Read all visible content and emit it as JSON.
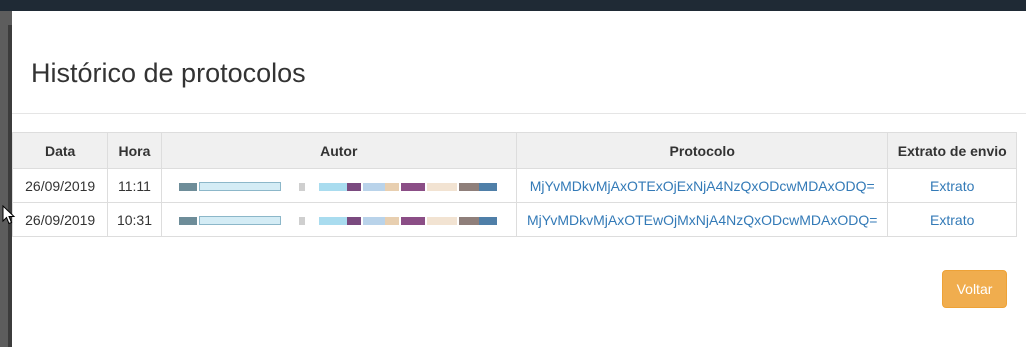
{
  "modal": {
    "title": "Histórico de protocolos",
    "close_label": "Voltar",
    "accent_color": "#f0ad4e",
    "link_color": "#337ab7"
  },
  "table": {
    "headers": [
      "Data",
      "Hora",
      "Autor",
      "Protocolo",
      "Extrato de envio"
    ],
    "rows": [
      {
        "data": "26/09/2019",
        "hora": "11:11",
        "autor": "[redacted]",
        "protocolo": "MjYvMDkvMjAxOTExOjExNjA4NzQxODcwMDAxODQ=",
        "extrato": "Extrato"
      },
      {
        "data": "26/09/2019",
        "hora": "10:31",
        "autor": "[redacted]",
        "protocolo": "MjYvMDkvMjAxOTEwOjMxNjA4NzQxODcwMDAxODQ=",
        "extrato": "Extrato"
      }
    ]
  }
}
